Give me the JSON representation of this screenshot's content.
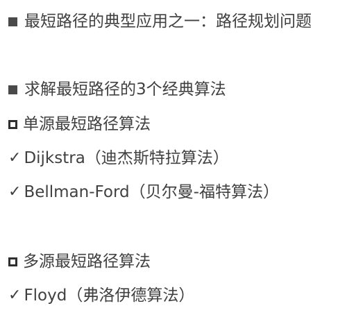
{
  "lines": [
    {
      "bullet": "square",
      "text": "最短路径的典型应用之一：路径规划问题"
    },
    {
      "bullet": "square",
      "text": "求解最短路径的3个经典算法"
    },
    {
      "bullet": "hollow",
      "text": "单源最短路径算法"
    },
    {
      "bullet": "check",
      "symbol": "✓",
      "text": "Dijkstra（迪杰斯特拉算法）"
    },
    {
      "bullet": "check",
      "symbol": "✓",
      "text": "Bellman-Ford（贝尔曼-福特算法）"
    },
    {
      "bullet": "hollow",
      "text": "多源最短路径算法"
    },
    {
      "bullet": "check",
      "symbol": "✓",
      "text": "Floyd（弗洛伊德算法）"
    }
  ]
}
